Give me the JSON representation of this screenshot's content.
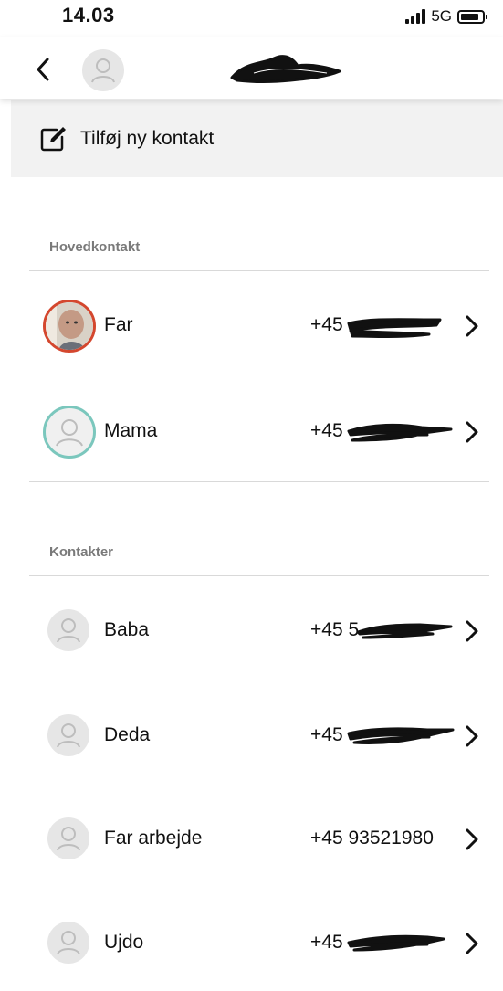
{
  "status_bar": {
    "time": "14.03",
    "network": "5G"
  },
  "nav": {
    "back_icon": "chevron-left-icon"
  },
  "add_contact": {
    "label": "Tilføj ny kontakt",
    "icon": "edit-icon"
  },
  "sections": {
    "main_contact_header": "Hovedkontakt",
    "contacts_header": "Kontakter"
  },
  "main_contacts": [
    {
      "name": "Far",
      "phone": "+45",
      "avatar": "photo",
      "ring_color": "#d4472e"
    },
    {
      "name": "Mama",
      "phone": "+45",
      "avatar": "placeholder",
      "ring_color": "#7bc7bd"
    }
  ],
  "contacts": [
    {
      "name": "Baba",
      "phone": "+45 5"
    },
    {
      "name": "Deda",
      "phone": "+45"
    },
    {
      "name": "Far arbejde",
      "phone": "+45 93521980"
    },
    {
      "name": "Ujdo",
      "phone": "+45"
    }
  ],
  "colors": {
    "accent_red": "#d4472e",
    "accent_teal": "#7bc7bd",
    "header_bg": "#f2f2f2",
    "divider": "#d9d9d9"
  }
}
